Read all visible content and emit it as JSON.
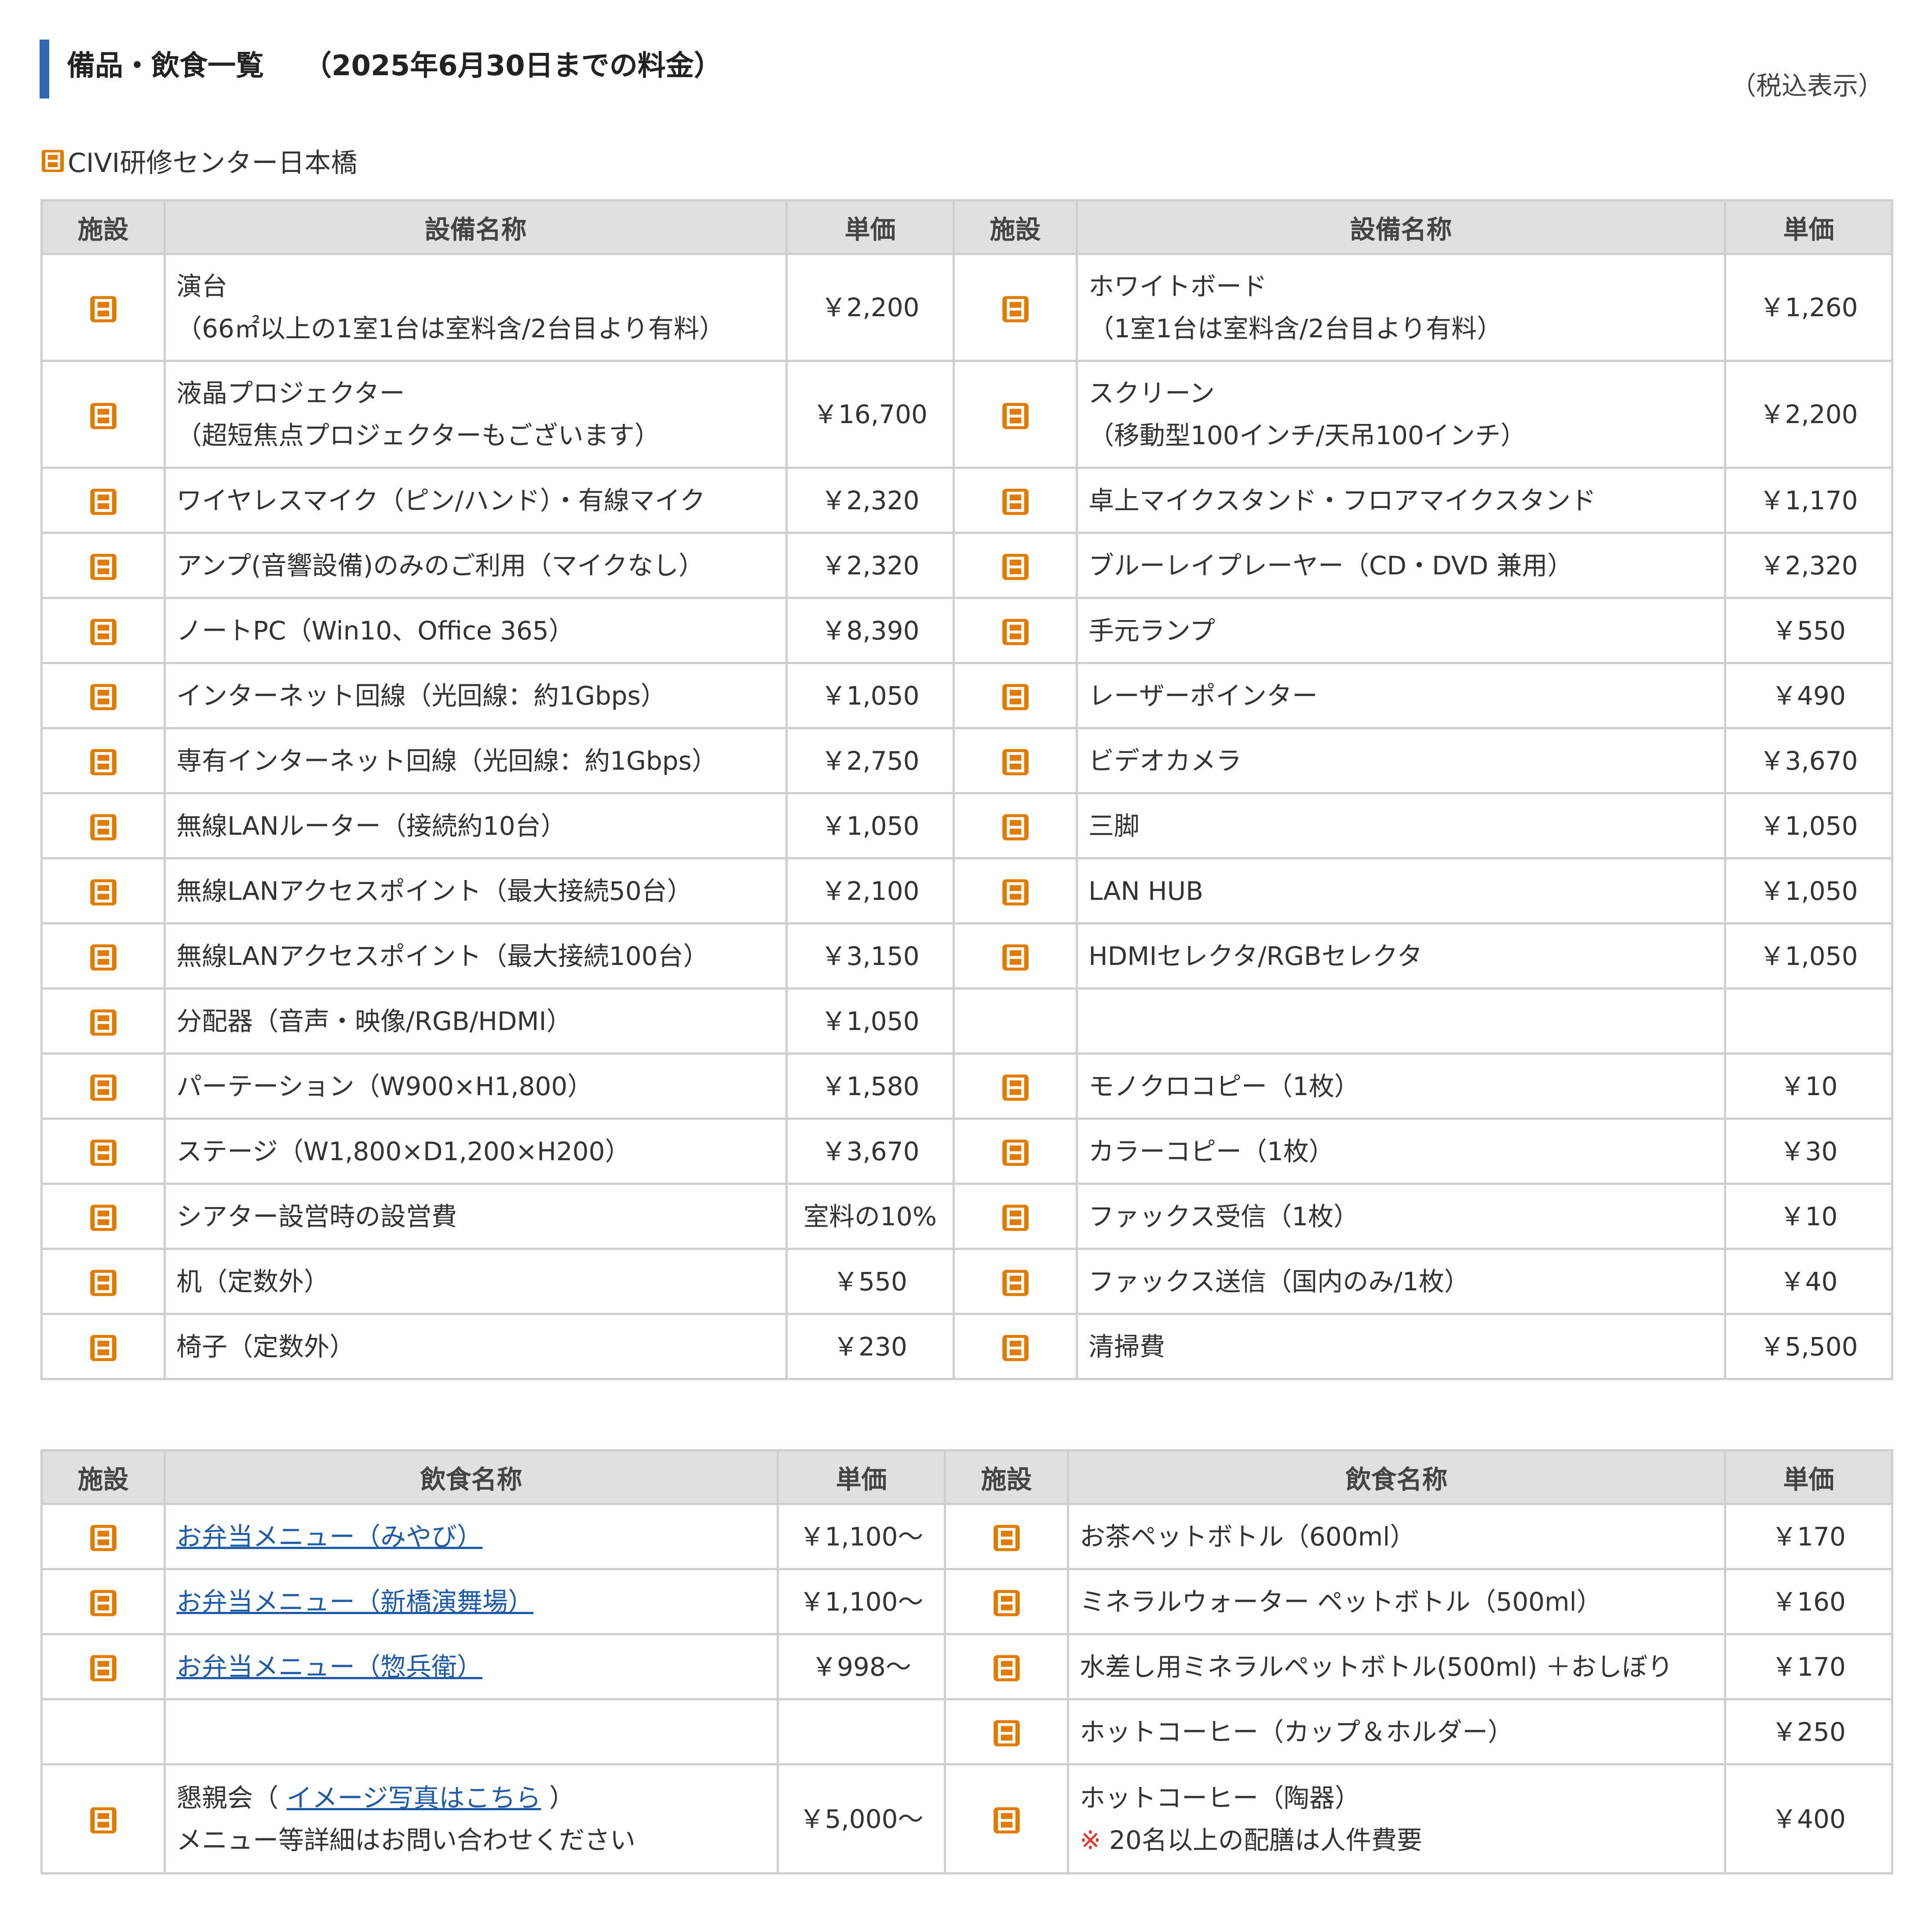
{
  "page": {
    "title": "備品・飲食一覧",
    "period": "（2025年6月30日までの料金）",
    "tax_note": "（税込表示）",
    "facility_name": "CIVI研修センター日本橋"
  },
  "colors": {
    "accent_bar": "#2f67b1",
    "icon_orange": "#e07b00",
    "link": "#1f5aa6",
    "header_bg": "#e0e0e0",
    "note_red": "#e0302a"
  },
  "icons": {
    "facility_badge": "facility-nihonbashi-icon"
  },
  "equipment": {
    "headers": {
      "facility": "施設",
      "name": "設備名称",
      "price": "単価"
    },
    "rows": [
      {
        "left": {
          "name": "演台",
          "sub": "（66㎡以上の1室1台は室料含/2台目より有料）",
          "price": "￥2,200"
        },
        "right": {
          "name": "ホワイトボード",
          "sub": "（1室1台は室料含/2台目より有料）",
          "price": "￥1,260"
        }
      },
      {
        "left": {
          "name": "液晶プロジェクター",
          "sub": "（超短焦点プロジェクターもございます）",
          "price": "￥16,700"
        },
        "right": {
          "name": "スクリーン",
          "sub": "（移動型100インチ/天吊100インチ）",
          "price": "￥2,200"
        }
      },
      {
        "left": {
          "name": "ワイヤレスマイク（ピン/ハンド）・有線マイク",
          "price": "￥2,320"
        },
        "right": {
          "name": "卓上マイクスタンド・フロアマイクスタンド",
          "price": "￥1,170"
        }
      },
      {
        "left": {
          "name": "アンプ(音響設備)のみのご利用（マイクなし）",
          "price": "￥2,320"
        },
        "right": {
          "name": "ブルーレイプレーヤー（CD・DVD 兼用）",
          "price": "￥2,320"
        }
      },
      {
        "left": {
          "name": "ノートPC（Win10、Office 365）",
          "price": "￥8,390"
        },
        "right": {
          "name": "手元ランプ",
          "price": "￥550"
        }
      },
      {
        "left": {
          "name": "インターネット回線（光回線：約1Gbps）",
          "price": "￥1,050"
        },
        "right": {
          "name": "レーザーポインター",
          "price": "￥490"
        }
      },
      {
        "left": {
          "name": "専有インターネット回線（光回線：約1Gbps）",
          "price": "￥2,750"
        },
        "right": {
          "name": "ビデオカメラ",
          "price": "￥3,670"
        }
      },
      {
        "left": {
          "name": "無線LANルーター（接続約10台）",
          "price": "￥1,050"
        },
        "right": {
          "name": "三脚",
          "price": "￥1,050"
        }
      },
      {
        "left": {
          "name": "無線LANアクセスポイント（最大接続50台）",
          "price": "￥2,100"
        },
        "right": {
          "name": "LAN HUB",
          "price": "￥1,050"
        }
      },
      {
        "left": {
          "name": "無線LANアクセスポイント（最大接続100台）",
          "price": "￥3,150"
        },
        "right": {
          "name": "HDMIセレクタ/RGBセレクタ",
          "price": "￥1,050"
        }
      },
      {
        "left": {
          "name": "分配器（音声・映像/RGB/HDMI）",
          "price": "￥1,050"
        },
        "right": null
      },
      {
        "left": {
          "name": "パーテーション（W900×H1,800）",
          "price": "￥1,580"
        },
        "right": {
          "name": "モノクロコピー（1枚）",
          "price": "￥10"
        }
      },
      {
        "left": {
          "name": "ステージ（W1,800×D1,200×H200）",
          "price": "￥3,670"
        },
        "right": {
          "name": "カラーコピー（1枚）",
          "price": "￥30"
        }
      },
      {
        "left": {
          "name": "シアター設営時の設営費",
          "price": "室料の10%"
        },
        "right": {
          "name": "ファックス受信（1枚）",
          "price": "￥10"
        }
      },
      {
        "left": {
          "name": "机（定数外）",
          "price": "￥550"
        },
        "right": {
          "name": "ファックス送信（国内のみ/1枚）",
          "price": "￥40"
        }
      },
      {
        "left": {
          "name": "椅子（定数外）",
          "price": "￥230"
        },
        "right": {
          "name": "清掃費",
          "price": "￥5,500"
        }
      }
    ]
  },
  "food": {
    "headers": {
      "facility": "施設",
      "name": "飲食名称",
      "price": "単価"
    },
    "rows": [
      {
        "left": {
          "link": "お弁当メニュー（みやび）",
          "price": "￥1,100～"
        },
        "right": {
          "name": "お茶ペットボトル（600ml）",
          "price": "￥170"
        }
      },
      {
        "left": {
          "link": "お弁当メニュー（新橋演舞場）",
          "price": "￥1,100～"
        },
        "right": {
          "name": "ミネラルウォーター ペットボトル（500ml）",
          "price": "￥160"
        }
      },
      {
        "left": {
          "link": "お弁当メニュー（惣兵衛）",
          "price": "￥998～"
        },
        "right": {
          "name": "水差し用ミネラルペットボトル(500ml) ＋おしぼり",
          "price": "￥170"
        }
      },
      {
        "left": null,
        "right": {
          "name": "ホットコーヒー（カップ＆ホルダー）",
          "price": "￥250"
        }
      },
      {
        "left": {
          "prefix": "懇親会（ ",
          "link": "イメージ写真はこちら",
          "suffix": " ）",
          "sub": "メニュー等詳細はお問い合わせください",
          "price": "￥5,000～"
        },
        "right": {
          "name": "ホットコーヒー（陶器）",
          "note_mark": "※",
          "note": " 20名以上の配膳は人件費要",
          "price": "￥400"
        }
      }
    ]
  }
}
